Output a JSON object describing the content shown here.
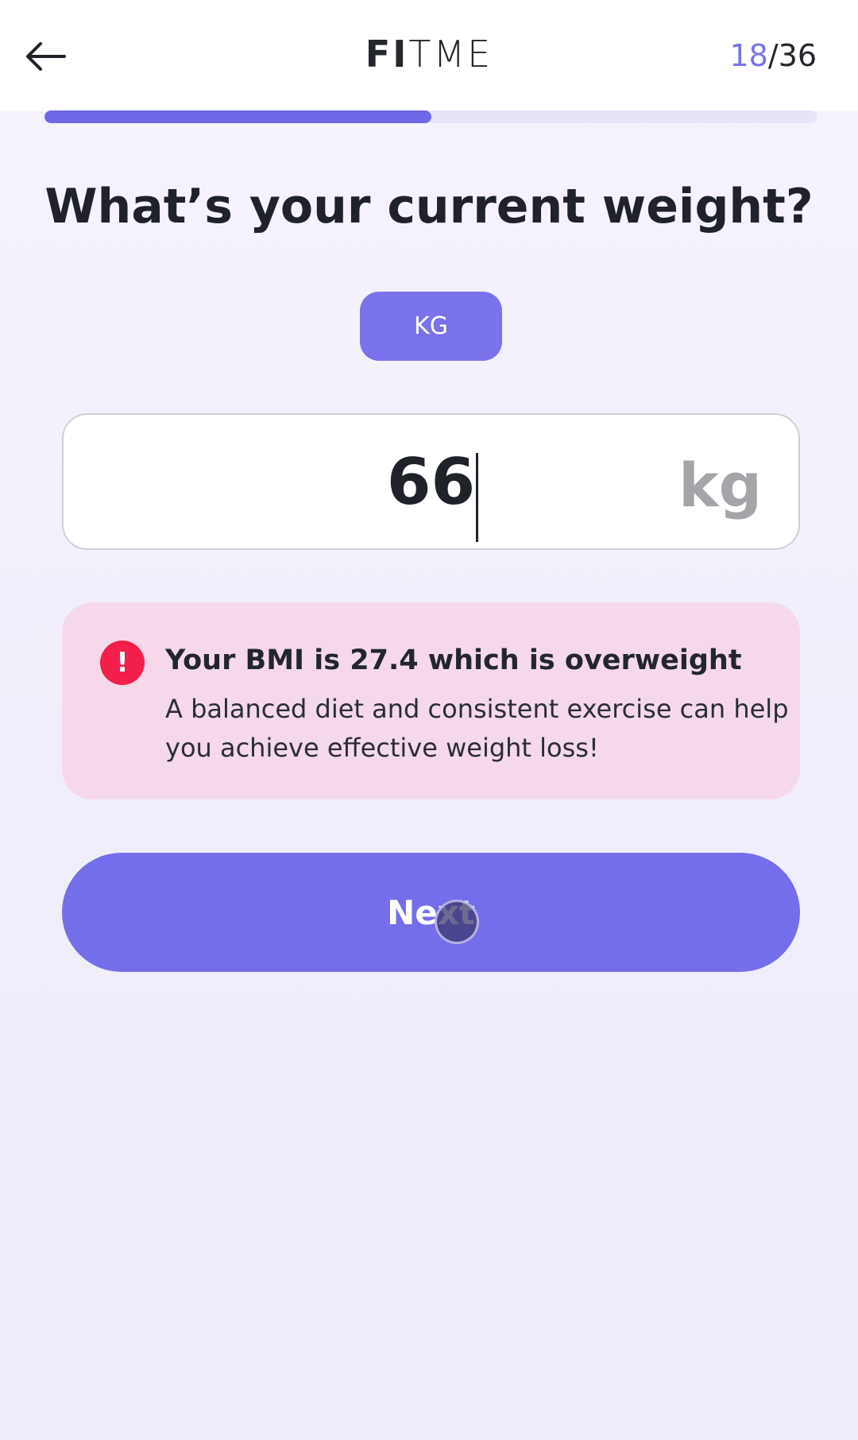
{
  "header": {
    "back_icon": "arrow-left-icon",
    "logo_bold": "FI",
    "logo_light": "TME",
    "step_current": "18",
    "step_total": "/36"
  },
  "progress": {
    "fraction": 0.5
  },
  "question": {
    "title": "What’s your current weight?"
  },
  "unit_selector": {
    "selected": "KG"
  },
  "weight_input": {
    "value": "66",
    "unit": "kg"
  },
  "bmi_notice": {
    "icon": "exclamation-circle-icon",
    "icon_glyph": "!",
    "headline": "Your BMI is 27.4 which is overweight",
    "body": "A balanced diet and consistent exercise can help you achieve effective weight loss!"
  },
  "actions": {
    "next_label": "Next"
  },
  "colors": {
    "accent": "#756eea",
    "alert": "#f21f4a",
    "notice_bg": "#f5d9eb"
  }
}
